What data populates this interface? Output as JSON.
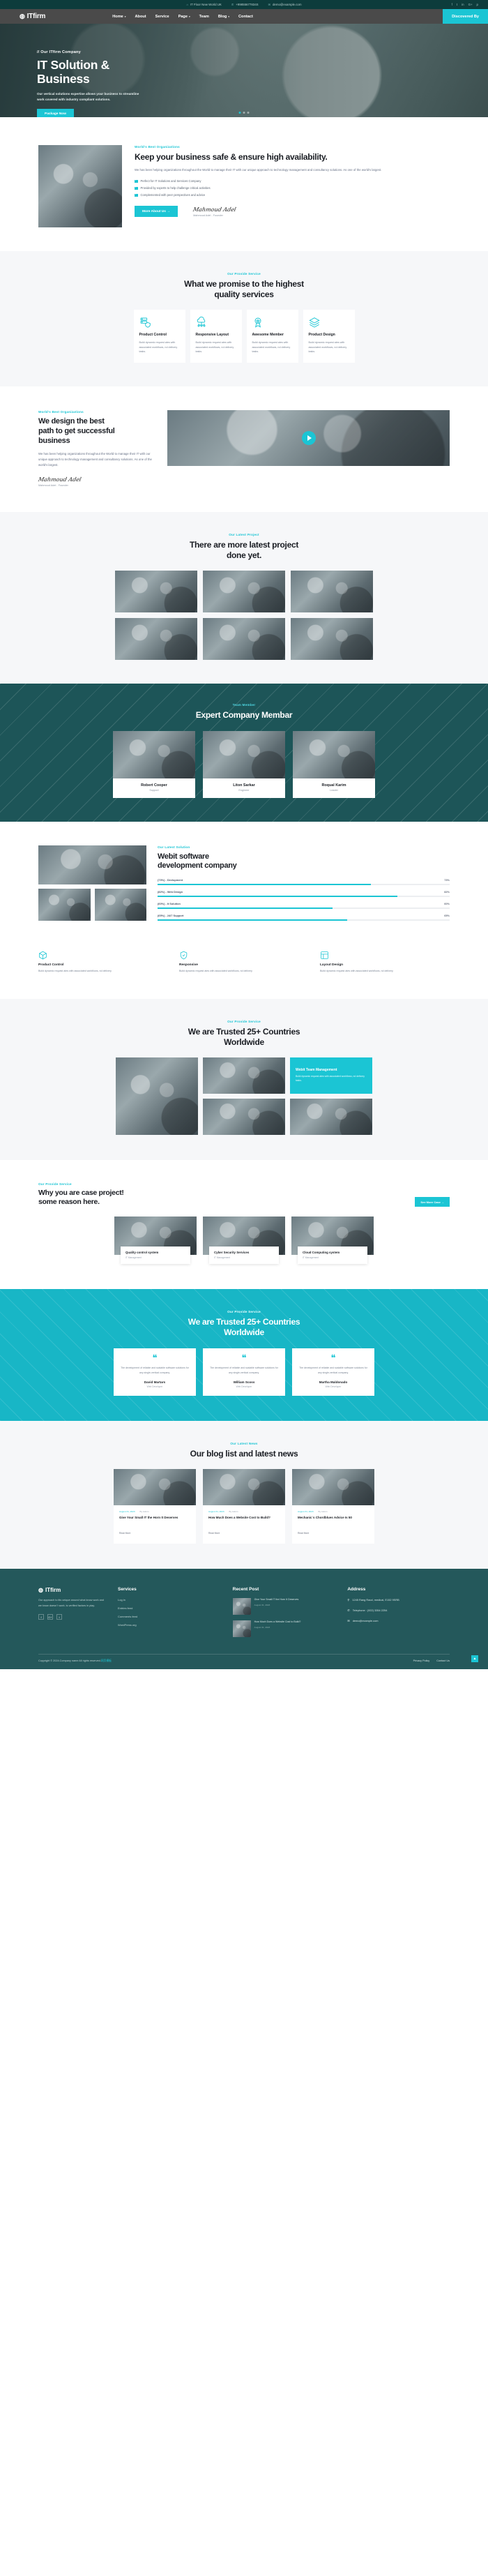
{
  "topbar": {
    "address": "IT Floor New World UK",
    "phone": "+99855677834S",
    "email": "demo@example.com",
    "socials": [
      "f",
      "t",
      "in",
      "G+",
      "p"
    ]
  },
  "nav": {
    "brand": "ITfirm",
    "links": [
      {
        "label": "Home",
        "caret": "▾"
      },
      {
        "label": "About",
        "caret": ""
      },
      {
        "label": "Service",
        "caret": ""
      },
      {
        "label": "Page",
        "caret": "▾"
      },
      {
        "label": "Team",
        "caret": ""
      },
      {
        "label": "Blog",
        "caret": "▾"
      },
      {
        "label": "Contact",
        "caret": ""
      }
    ],
    "cta": "Discovered By"
  },
  "hero": {
    "kicker": "// Our ITfirm Company",
    "title_line1": "IT Solution &",
    "title_line2": "Business",
    "paragraph": "Our vertical solutions expertise allows your business to streamline work covered with industry compliant solutions.",
    "button": "Package Now"
  },
  "about": {
    "kicker": "World's Best Organizations",
    "title": "Keep your business safe & ensure high availability.",
    "paragraph": "We has been helping organizations throughout the World to manage their IT with our unique approach to technology management and consultancy solutions. As one of the world's largest.",
    "checks": [
      "Perfect for IT Solutions and Services Company",
      "Provided by experts to help challenge critical activities",
      "Complemented with peer perspectives and advice"
    ],
    "button": "More About Us  →",
    "signature": "Mahmoud Adel",
    "signature_name": "Mahmoud Adel - Founder"
  },
  "services": {
    "kicker": "Our Provide Service",
    "title_line1": "What we promise to the highest",
    "title_line2": "quality services",
    "cards": [
      {
        "icon": "server-shield-icon",
        "title": "Product Control",
        "text": "Build dynamic request ates with associated workflows, nd delivery tasks."
      },
      {
        "icon": "cloud-network-icon",
        "title": "Responsive Layout",
        "text": "Build dynamic request ates with associated workflows, nd delivery tasks."
      },
      {
        "icon": "badge-award-icon",
        "title": "Awesome Member",
        "text": "Build dynamic request ates with associated workflows, nd delivery tasks."
      },
      {
        "icon": "layers-design-icon",
        "title": "Product Design",
        "text": "Build dynamic request ates with associated workflows, nd delivery tasks."
      }
    ]
  },
  "design": {
    "kicker": "World's Best Organizations",
    "title_line1": "We design the best",
    "title_line2": "path to get successful",
    "title_line3": "business",
    "paragraph": "We has been helping organizations throughout the World to manage their IT with our unique approach to technology management and consultancy solutions. As one of the world's largest.",
    "signature": "Mahmoud Adel",
    "signature_name": "Mahmoud Adel - Founder",
    "play": "play-button"
  },
  "projects": {
    "kicker": "Our Latest Project",
    "title_line1": "There are more latest project",
    "title_line2": "done yet.",
    "count": 6
  },
  "team": {
    "kicker": "Team Member",
    "title": "Expert Company Membar",
    "members": [
      {
        "name": "Robert Cooper",
        "role": "Support"
      },
      {
        "name": "Liton Sarkar",
        "role": "Engineer"
      },
      {
        "name": "Roqual Karim",
        "role": "Leader"
      }
    ]
  },
  "skills": {
    "kicker": "Our Latest Solution",
    "title_line1": "Webit software",
    "title_line2": "development company",
    "bars": [
      {
        "label": "(73%) - Devlopment",
        "pct_label": "73%",
        "value": 73
      },
      {
        "label": "(82%) - Web Design",
        "pct_label": "82%",
        "value": 82
      },
      {
        "label": "(60%) - It Solution",
        "pct_label": "60%",
        "value": 60
      },
      {
        "label": "(65%) - 24/7 Support",
        "pct_label": "65%",
        "value": 65
      }
    ],
    "features": [
      {
        "icon": "cube-icon",
        "title": "Product Control",
        "text": "Build dynamic request ates with associated workflows, nd delivery"
      },
      {
        "icon": "shield-icon",
        "title": "Responsive",
        "text": "Build dynamic request ates with associated workflows, nd delivery"
      },
      {
        "icon": "layout-icon",
        "title": "Layout Design",
        "text": "Build dynamic request ates with associated workflows, nd delivery"
      }
    ]
  },
  "trusted": {
    "kicker": "Our Provide Service",
    "title_line1": "We are Trusted 25+ Countries",
    "title_line2": "Worldwide",
    "accent": {
      "title": "Webit Team Management",
      "text": "Build dynamic request ates with associated workflows, nd delivery tasks."
    }
  },
  "cases": {
    "kicker": "Our Provide Service",
    "title_line1": "Why you are case project!",
    "title_line2": "some reason here.",
    "button": "See More Case  →",
    "items": [
      {
        "title": "Quality control system",
        "sub": "IT Management"
      },
      {
        "title": "Cyber Security Services",
        "sub": "IT Management"
      },
      {
        "title": "Cloud Computing system",
        "sub": "IT Management"
      }
    ]
  },
  "testimonials": {
    "kicker": "Our Provide Service",
    "title_line1": "We are Trusted 25+ Countries",
    "title_line2": "Worldwide",
    "items": [
      {
        "quote": "The development of reliable and scalable software solutions for any single-vertical company.",
        "name": "David Martars",
        "role": "Web Developer"
      },
      {
        "quote": "The development of reliable and scalable software solutions for any single-vertical company.",
        "name": "William Scoss",
        "role": "Web Developer"
      },
      {
        "quote": "The development of reliable and scalable software solutions for any single-vertical company.",
        "name": "Martha Maldonado",
        "role": "Web Developer"
      }
    ]
  },
  "blog": {
    "kicker": "Our Latest News",
    "title": "Our blog list and latest news",
    "posts": [
      {
        "date": "August 31, 2023",
        "author": "By Admin",
        "title": "Give Your Small IT the Horn It Deserves",
        "read": "Read More"
      },
      {
        "date": "August 31, 2023",
        "author": "By Admin",
        "title": "How Much Does a Website Cost to Build?",
        "read": "Read More"
      },
      {
        "date": "August 31, 2023",
        "author": "By Admin",
        "title": "Mechanic`s Chordblues Advice Is 50",
        "read": "Read More"
      }
    ]
  },
  "footer": {
    "brand": "ITfirm",
    "about": "Our approach to itis unique around what know work and we know doesn`t work. is verified factors in play.",
    "socials": [
      "f",
      "G+",
      "t"
    ],
    "services_title": "Services",
    "services": [
      "Log in",
      "Entries feed",
      "Comments feed",
      "WordPress.org"
    ],
    "recent_title": "Recent Post",
    "recent": [
      {
        "title": "Give Your Small IT the Horn It Deserves",
        "date": "August 31, 2023"
      },
      {
        "title": "How Much Does a Website Cost to Build?",
        "date": "August 31, 2023"
      }
    ],
    "address_title": "Address",
    "address": "1245 Rang Raod, medical, E152 9SRB",
    "telephone": "Telephone : (922) 3354 2254",
    "email": "demo@example.com",
    "copyright": "Copyright © 2024.Company name All rights reserved.",
    "copyright_link": "网页模板",
    "bottom_links": [
      "Privacy Policy",
      "Contact Us"
    ],
    "totop": "▲"
  }
}
